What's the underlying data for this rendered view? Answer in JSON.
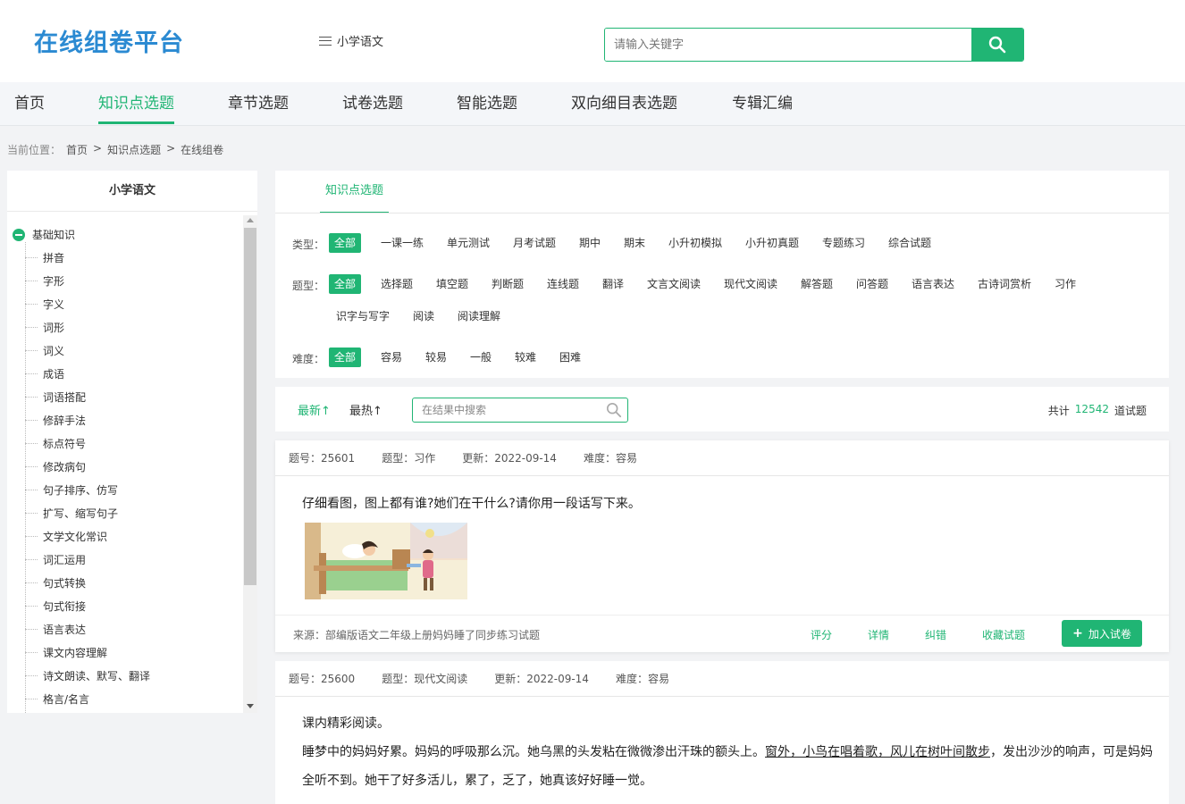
{
  "header": {
    "logo": "在线组卷平台",
    "subject": "小学语文",
    "search_placeholder": "请输入关键字"
  },
  "nav": {
    "items": [
      "首页",
      "知识点选题",
      "章节选题",
      "试卷选题",
      "智能选题",
      "双向细目表选题",
      "专辑汇编"
    ],
    "active_index": 1
  },
  "breadcrumb": {
    "prefix": "当前位置：",
    "items": [
      "首页",
      "知识点选题",
      "在线组卷"
    ],
    "separator": ">"
  },
  "sidebar": {
    "title": "小学语文",
    "root": "基础知识",
    "items": [
      "拼音",
      "字形",
      "字义",
      "词形",
      "词义",
      "成语",
      "词语搭配",
      "修辞手法",
      "标点符号",
      "修改病句",
      "句子排序、仿写",
      "扩写、缩写句子",
      "文学文化常识",
      "词汇运用",
      "句式转换",
      "句式衔接",
      "语言表达",
      "课文内容理解",
      "诗文朗读、默写、翻译",
      "格言/名言"
    ]
  },
  "filters": {
    "tab": "知识点选题",
    "type": {
      "label": "类型：",
      "options": [
        "全部",
        "一课一练",
        "单元测试",
        "月考试题",
        "期中",
        "期末",
        "小升初模拟",
        "小升初真题",
        "专题练习",
        "综合试题"
      ]
    },
    "qtype": {
      "label": "题型：",
      "options": [
        "全部",
        "选择题",
        "填空题",
        "判断题",
        "连线题",
        "翻译",
        "文言文阅读",
        "现代文阅读",
        "解答题",
        "问答题",
        "语言表达",
        "古诗词赏析",
        "习作",
        "识字与写字",
        "阅读",
        "阅读理解"
      ]
    },
    "difficulty": {
      "label": "难度：",
      "options": [
        "全部",
        "容易",
        "较易",
        "一般",
        "较难",
        "困难"
      ]
    }
  },
  "sort": {
    "newest": "最新↑",
    "hottest": "最热↑",
    "search_placeholder": "在结果中搜索",
    "total_prefix": "共计",
    "total_count": "12542",
    "total_suffix": "道试题"
  },
  "questions": [
    {
      "id": "题号：25601",
      "type": "题型：习作",
      "updated": "更新：2022-09-14",
      "difficulty": "难度：容易",
      "text": "仔细看图，图上都有谁?她们在干什么?请你用一段话写下来。",
      "source": "来源：部编版语文二年级上册妈妈睡了同步练习试题",
      "actions": [
        "评分",
        "详情",
        "纠错",
        "收藏试题"
      ],
      "add_label": "加入试卷"
    },
    {
      "id": "题号：25600",
      "type": "题型：现代文阅读",
      "updated": "更新：2022-09-14",
      "difficulty": "难度：容易",
      "title": "课内精彩阅读。",
      "para_a": "睡梦中的妈妈好累。妈妈的呼吸那么沉。她乌黑的头发粘在微微渗出汗珠的额头上。",
      "para_u": "窗外，小鸟在唱着歌，风儿在树叶间散步",
      "para_b": "，发出沙沙的响声，可是妈妈",
      "para_c": "全听不到。她干了好多活儿，累了，乏了，她真该好好睡一觉。"
    }
  ],
  "colors": {
    "accent": "#20b574",
    "logo": "#2b8ad2"
  }
}
